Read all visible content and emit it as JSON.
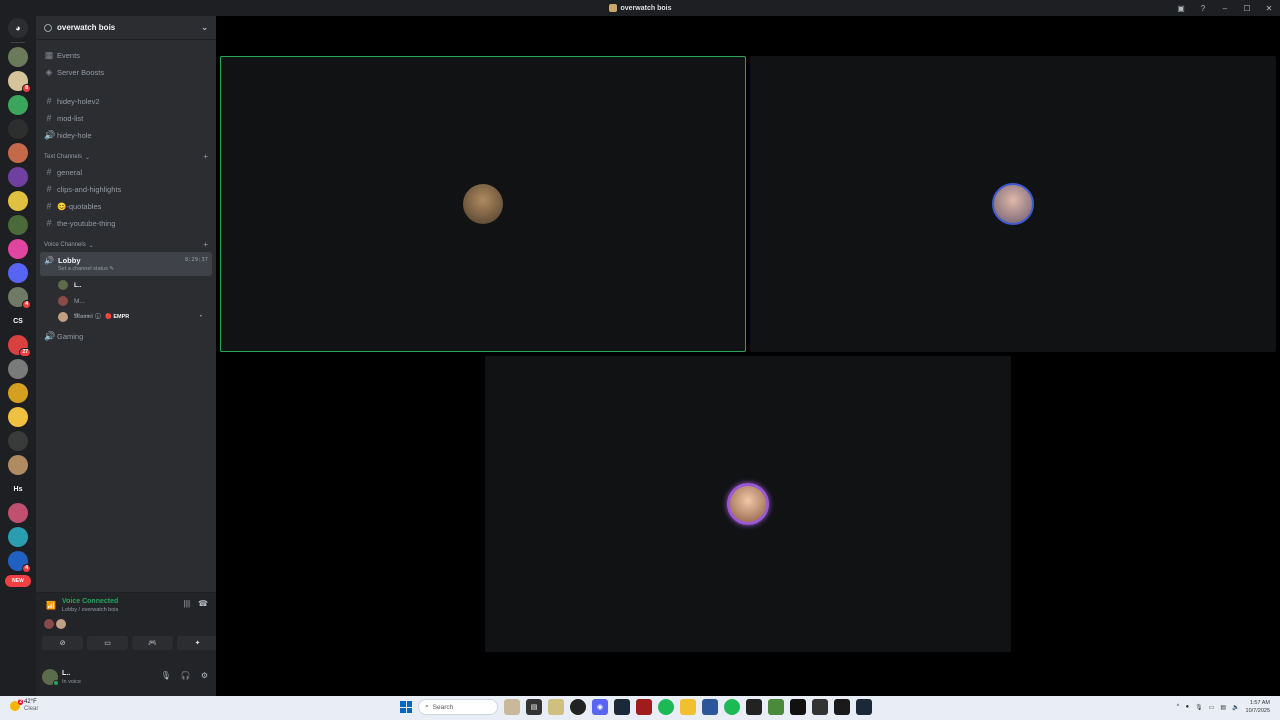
{
  "window": {
    "title": "overwatch bois",
    "controls": [
      "inbox-icon",
      "help-icon",
      "minimize",
      "maximize",
      "close"
    ]
  },
  "server_list": [
    {
      "name": "discord-home",
      "color": "#2b2d31",
      "label": ""
    },
    {
      "name": "server-1",
      "color": "#6b7a5a",
      "label": ""
    },
    {
      "name": "server-2",
      "color": "#d6c39a",
      "label": "",
      "badge": "8"
    },
    {
      "name": "server-3",
      "color": "#3ba55c",
      "label": ""
    },
    {
      "name": "server-4",
      "color": "#2e2e2e",
      "label": ""
    },
    {
      "name": "server-5",
      "color": "#c46a4a",
      "label": ""
    },
    {
      "name": "server-6",
      "color": "#7040a0",
      "label": ""
    },
    {
      "name": "server-7",
      "color": "#e0c040",
      "label": ""
    },
    {
      "name": "server-8",
      "color": "#4a6a3a",
      "label": ""
    },
    {
      "name": "server-9",
      "color": "#e0459f",
      "label": ""
    },
    {
      "name": "server-10",
      "color": "#5865f2",
      "label": ""
    },
    {
      "name": "server-11",
      "color": "#6f7a66",
      "label": "",
      "badge": "4"
    },
    {
      "name": "server-cs",
      "color": "#1e1f22",
      "label": "CS"
    },
    {
      "name": "server-12",
      "color": "#d94040",
      "label": "",
      "badge": "27"
    },
    {
      "name": "server-13",
      "color": "#7a7a7a",
      "label": ""
    },
    {
      "name": "server-14",
      "color": "#d4a020",
      "label": ""
    },
    {
      "name": "server-15",
      "color": "#f0c040",
      "label": ""
    },
    {
      "name": "server-16",
      "color": "#3a3a3a",
      "label": ""
    },
    {
      "name": "server-17",
      "color": "#b08a60",
      "label": ""
    },
    {
      "name": "server-hs",
      "color": "#1e1f22",
      "label": "Hs"
    },
    {
      "name": "server-18",
      "color": "#c05070",
      "label": ""
    },
    {
      "name": "server-19",
      "color": "#2a9db0",
      "label": ""
    },
    {
      "name": "server-20",
      "color": "#2060c0",
      "label": "",
      "badge": "4"
    }
  ],
  "new_pill": "NEW",
  "server_header": {
    "name": "overwatch bois"
  },
  "channels": {
    "events": "Events",
    "server_boosts": "Server Boosts",
    "top": [
      {
        "label": "hidey-holev2",
        "icon": "#"
      },
      {
        "label": "mod-list",
        "icon": "#"
      },
      {
        "label": "hidey-hole",
        "icon": "🔊"
      }
    ],
    "text_category": "Text Channels",
    "text": [
      {
        "label": "general",
        "icon": "#"
      },
      {
        "label": "clips-and-highlights",
        "icon": "#"
      },
      {
        "label": "😊-quotables",
        "icon": "#"
      },
      {
        "label": "the-youtube-thing",
        "icon": "#"
      }
    ],
    "voice_category": "Voice Channels",
    "lobby": {
      "name": "Lobby",
      "status": "Set a channel status ✎",
      "time": "8:29:37"
    },
    "lobby_users": [
      {
        "name": "L..",
        "color": "#5b6b4b",
        "tag": ""
      },
      {
        "name": "M...",
        "color": "#8a4a4a",
        "tag": ""
      },
      {
        "name": "𝕸𝖆𝖔𝖒𝖎 ①",
        "color": "#c0a080",
        "tag": "🔴 EMPR"
      }
    ],
    "gaming": "Gaming"
  },
  "voice_panel": {
    "status": "Voice Connected",
    "location": "Lobby / overwatch bois",
    "buttons": [
      "camera-off",
      "screen-share",
      "activity",
      "soundboard"
    ]
  },
  "user_panel": {
    "name": "L..",
    "status": "In voice"
  },
  "tiles": [
    {
      "name": "tile-user-1",
      "speaking": true,
      "avatar_color": "#6b5a45"
    },
    {
      "name": "tile-user-2",
      "speaking": false,
      "avatar_color": "#9a7b7b"
    },
    {
      "name": "tile-user-3",
      "speaking": false,
      "avatar_color": "#c89a80"
    }
  ],
  "taskbar": {
    "temp": "42°F",
    "condition": "Clear",
    "weather_badge": "2",
    "search_placeholder": "Search",
    "time": "1:57 AM",
    "date": "10/7/2025"
  }
}
